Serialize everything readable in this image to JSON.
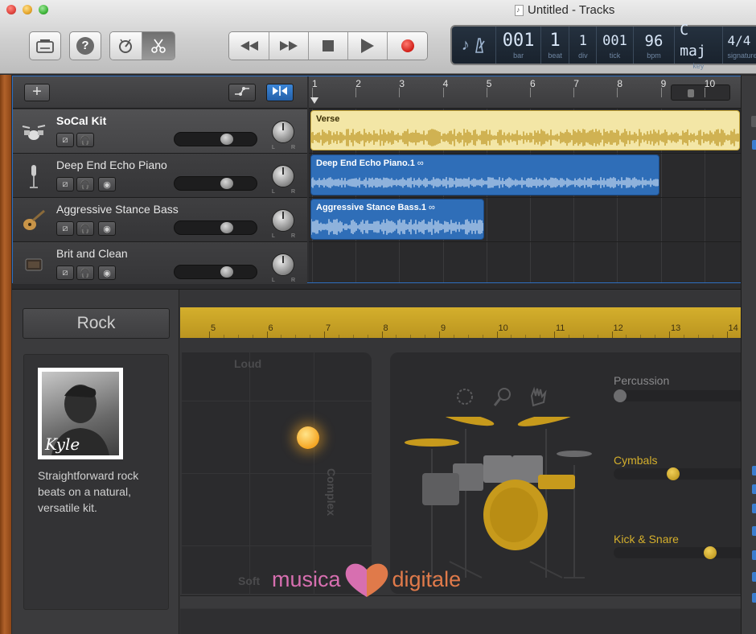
{
  "window": {
    "title": "Untitled - Tracks"
  },
  "toolbar": {
    "library_icon": "library-icon",
    "help_label": "?",
    "smart_controls_icon": "smart-controls-icon",
    "editors_icon": "scissors-icon",
    "transport": [
      "rewind-icon",
      "fast-forward-icon",
      "stop-icon",
      "play-icon",
      "record-icon"
    ]
  },
  "lcd": {
    "mode_icon": "metronome-icon",
    "bar": {
      "value": "001",
      "label": "bar"
    },
    "beat": {
      "value": "1",
      "label": "beat"
    },
    "div": {
      "value": "1",
      "label": "div"
    },
    "tick": {
      "value": "001",
      "label": "tick"
    },
    "bpm": {
      "value": "96",
      "label": "bpm"
    },
    "key": {
      "value": "C maj",
      "label": "key"
    },
    "signature": {
      "value": "4/4",
      "label": "signature"
    }
  },
  "tracks_header": {
    "add_label": "+"
  },
  "ruler": {
    "bars": [
      "1",
      "2",
      "3",
      "4",
      "5",
      "6",
      "7",
      "8",
      "9",
      "10"
    ]
  },
  "tracks": [
    {
      "name": "SoCal Kit",
      "icon": "drum-kit-icon",
      "selected": true,
      "volume": 0.68
    },
    {
      "name": "Deep End Echo Piano",
      "icon": "microphone-icon",
      "selected": false,
      "volume": 0.68
    },
    {
      "name": "Aggressive Stance Bass",
      "icon": "guitar-icon",
      "selected": false,
      "volume": 0.68
    },
    {
      "name": "Brit and Clean",
      "icon": "amp-icon",
      "selected": false,
      "volume": 0.68
    }
  ],
  "regions": [
    {
      "title": "Verse",
      "track": 0,
      "color": "#f5e9b0"
    },
    {
      "title": "Deep End Echo Piano.1",
      "track": 1,
      "color": "#2f6eb8"
    },
    {
      "title": "Aggressive Stance Bass.1",
      "track": 2,
      "color": "#2f6eb8"
    }
  ],
  "editor": {
    "genre": "Rock",
    "drummer_signature": "Kyle",
    "drummer_description": "Straightforward rock beats on a natural, versatile kit.",
    "ruler_bars": [
      "5",
      "6",
      "7",
      "8",
      "9",
      "10",
      "11",
      "12",
      "13",
      "14"
    ],
    "pad": {
      "top": "Loud",
      "bottom": "Soft",
      "right": "Complex"
    },
    "kit_sections": [
      {
        "label": "Percussion",
        "active": false,
        "level": 0.0
      },
      {
        "label": "Cymbals",
        "active": true,
        "level": 0.45
      },
      {
        "label": "Kick & Snare",
        "active": true,
        "level": 0.75
      }
    ],
    "kit_icons": [
      "tambourine-icon",
      "shaker-icon",
      "clap-icon"
    ],
    "accent_color": "#d4af2c"
  },
  "watermark": {
    "part1": "musica",
    "part2": "digitale"
  }
}
